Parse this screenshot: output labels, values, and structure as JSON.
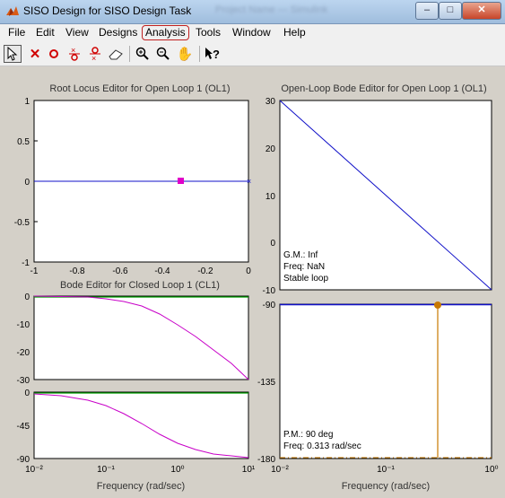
{
  "window": {
    "title": "SISO Design for SISO Design Task",
    "blurred_title": "Project Name — Simulink",
    "buttons": {
      "minimize": "–",
      "maximize": "□",
      "close": "✕"
    }
  },
  "menu": {
    "items": [
      {
        "label": "File"
      },
      {
        "label": "Edit"
      },
      {
        "label": "View"
      },
      {
        "label": "Designs"
      },
      {
        "label": "Analysis"
      },
      {
        "label": "Tools"
      },
      {
        "label": "Window"
      },
      {
        "label": "Help"
      }
    ]
  },
  "toolbar": {
    "icons": [
      "pointer-icon",
      "add-pole-icon",
      "add-zero-icon",
      "add-lead-icon",
      "add-lag-icon",
      "eraser-icon",
      "zoom-in-icon",
      "zoom-out-icon",
      "pan-hand-icon",
      "whats-this-icon"
    ]
  },
  "colors": {
    "axes_bg": "#ffffff",
    "fig_bg": "#d4d0c8",
    "blue": "#1010c8",
    "magenta": "#c800c8",
    "green": "#00a000",
    "orange": "#c87800"
  },
  "plots": {
    "root_locus": {
      "title": "Root Locus Editor for Open Loop 1 (OL1)",
      "xticks": [
        "-1",
        "-0.8",
        "-0.6",
        "-0.4",
        "-0.2",
        "0"
      ],
      "yticks": [
        "1",
        "0.5",
        "0",
        "-0.5",
        "-1"
      ]
    },
    "bode_ol": {
      "title": "Open-Loop Bode Editor for Open Loop 1 (OL1)",
      "mag_yticks": [
        "30",
        "20",
        "10",
        "0",
        "-10"
      ],
      "phase_yticks": [
        "-90",
        "-135",
        "-180"
      ],
      "xticks": [
        "10⁻²",
        "10⁻¹",
        "10⁰"
      ],
      "xlabel": "Frequency (rad/sec)",
      "gm_text": "G.M.: Inf",
      "gm_freq": "Freq: NaN",
      "stability": "Stable loop",
      "pm_text": "P.M.: 90 deg",
      "pm_freq": "Freq: 0.313 rad/sec"
    },
    "bode_cl": {
      "title": "Bode Editor for Closed Loop 1 (CL1)",
      "mag_yticks": [
        "0",
        "-10",
        "-20",
        "-30"
      ],
      "phase_yticks": [
        "0",
        "-45",
        "-90"
      ],
      "xticks": [
        "10⁻²",
        "10⁻¹",
        "10⁰",
        "10¹"
      ],
      "xlabel": "Frequency (rad/sec)"
    }
  },
  "chart_data": [
    {
      "type": "scatter",
      "title": "Root Locus Editor for Open Loop 1 (OL1)",
      "xlim": [
        -1,
        0
      ],
      "ylim": [
        -1,
        1
      ],
      "series": [
        {
          "values": [
            {
              "x": -0.313,
              "y": 0
            }
          ]
        }
      ]
    },
    {
      "type": "line",
      "title": "Open-Loop Bode Editor for Open Loop 1 (OL1)",
      "xlabel": "Frequency (rad/sec)",
      "xscale": "log",
      "xlim": [
        0.01,
        1
      ],
      "magnitude": {
        "ylim": [
          -10,
          30
        ],
        "x": [
          0.01,
          1
        ],
        "y": [
          30,
          -10
        ]
      },
      "phase": {
        "ylim": [
          -180,
          -90
        ],
        "x": [
          0.01,
          1
        ],
        "y": [
          -90,
          -90
        ],
        "pm_deg": 90,
        "pm_freq": 0.313
      }
    },
    {
      "type": "line",
      "title": "Bode Editor for Closed Loop 1 (CL1)",
      "xlabel": "Frequency (rad/sec)",
      "xscale": "log",
      "xlim": [
        0.01,
        10
      ],
      "magnitude": {
        "ylim": [
          -30,
          0
        ],
        "x": [
          0.01,
          0.1,
          0.313,
          1,
          3,
          10
        ],
        "y": [
          0,
          -0.4,
          -3,
          -10.4,
          -19.7,
          -30.1
        ]
      },
      "phase": {
        "ylim": [
          -90,
          0
        ],
        "x": [
          0.01,
          0.1,
          0.313,
          1,
          3,
          10
        ],
        "y": [
          -1.8,
          -17.4,
          -45,
          -72.6,
          -84,
          -88.2
        ]
      }
    }
  ]
}
